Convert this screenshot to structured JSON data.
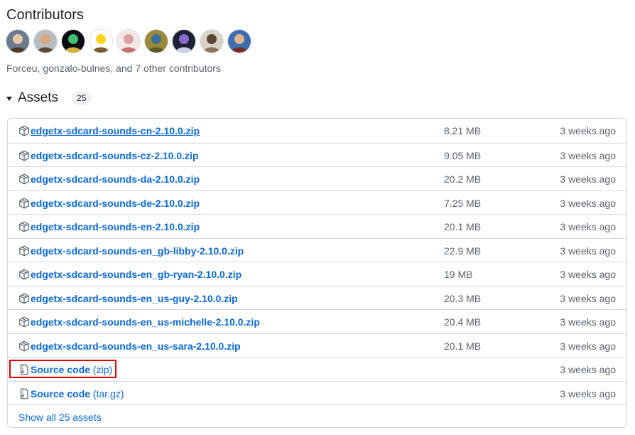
{
  "contributors": {
    "title": "Contributors",
    "summary": "Forceu, gonzalo-bulnes, and 7 other contributors",
    "avatars": [
      {
        "name": "avatar-1",
        "colors": [
          "#6b7a8c",
          "#e8c7a8",
          "#4a3b2e"
        ]
      },
      {
        "name": "avatar-2",
        "colors": [
          "#b8bdc2",
          "#d9a77a",
          "#5d4a3a"
        ]
      },
      {
        "name": "avatar-3",
        "colors": [
          "#0b0b14",
          "#3fbf6f",
          "#d8b13a"
        ]
      },
      {
        "name": "avatar-4",
        "colors": [
          "#ffffff",
          "#f7d51d",
          "#7a5b2d"
        ]
      },
      {
        "name": "avatar-5",
        "colors": [
          "#f3e7e7",
          "#d9a0a0",
          "#c77070"
        ]
      },
      {
        "name": "avatar-6",
        "colors": [
          "#9a8a3a",
          "#3c6e9c",
          "#5c5a2a"
        ]
      },
      {
        "name": "avatar-7",
        "colors": [
          "#1c2233",
          "#8a6acc",
          "#d0d0e8"
        ]
      },
      {
        "name": "avatar-8",
        "colors": [
          "#d8d2c8",
          "#5a4434",
          "#8c7662"
        ]
      },
      {
        "name": "avatar-9",
        "colors": [
          "#3b6fb2",
          "#e2b48c",
          "#7a2b2b"
        ]
      }
    ]
  },
  "assets": {
    "title": "Assets",
    "count": "25",
    "rows": [
      {
        "name": "edgetx-sdcard-sounds-cn-2.10.0.zip",
        "size": "8.21 MB",
        "date": "3 weeks ago",
        "icon": "package-icon"
      },
      {
        "name": "edgetx-sdcard-sounds-cz-2.10.0.zip",
        "size": "9.05 MB",
        "date": "3 weeks ago",
        "icon": "package-icon"
      },
      {
        "name": "edgetx-sdcard-sounds-da-2.10.0.zip",
        "size": "20.2 MB",
        "date": "3 weeks ago",
        "icon": "package-icon"
      },
      {
        "name": "edgetx-sdcard-sounds-de-2.10.0.zip",
        "size": "7.25 MB",
        "date": "3 weeks ago",
        "icon": "package-icon"
      },
      {
        "name": "edgetx-sdcard-sounds-en-2.10.0.zip",
        "size": "20.1 MB",
        "date": "3 weeks ago",
        "icon": "package-icon"
      },
      {
        "name": "edgetx-sdcard-sounds-en_gb-libby-2.10.0.zip",
        "size": "22.9 MB",
        "date": "3 weeks ago",
        "icon": "package-icon"
      },
      {
        "name": "edgetx-sdcard-sounds-en_gb-ryan-2.10.0.zip",
        "size": "19 MB",
        "date": "3 weeks ago",
        "icon": "package-icon"
      },
      {
        "name": "edgetx-sdcard-sounds-en_us-guy-2.10.0.zip",
        "size": "20.3 MB",
        "date": "3 weeks ago",
        "icon": "package-icon"
      },
      {
        "name": "edgetx-sdcard-sounds-en_us-michelle-2.10.0.zip",
        "size": "20.4 MB",
        "date": "3 weeks ago",
        "icon": "package-icon"
      },
      {
        "name": "edgetx-sdcard-sounds-en_us-sara-2.10.0.zip",
        "size": "20.1 MB",
        "date": "3 weeks ago",
        "icon": "package-icon"
      }
    ],
    "source_zip": {
      "label": "Source code",
      "paren": "(zip)",
      "date": "3 weeks ago",
      "icon": "file-zip-icon"
    },
    "source_targz": {
      "label": "Source code",
      "paren": "(tar.gz)",
      "date": "3 weeks ago",
      "icon": "file-zip-icon"
    },
    "show_all": "Show all 25 assets"
  },
  "colors": {
    "link": "#0969da",
    "muted": "#59636e",
    "border": "#d1d9e0",
    "highlight": "#e00000"
  }
}
